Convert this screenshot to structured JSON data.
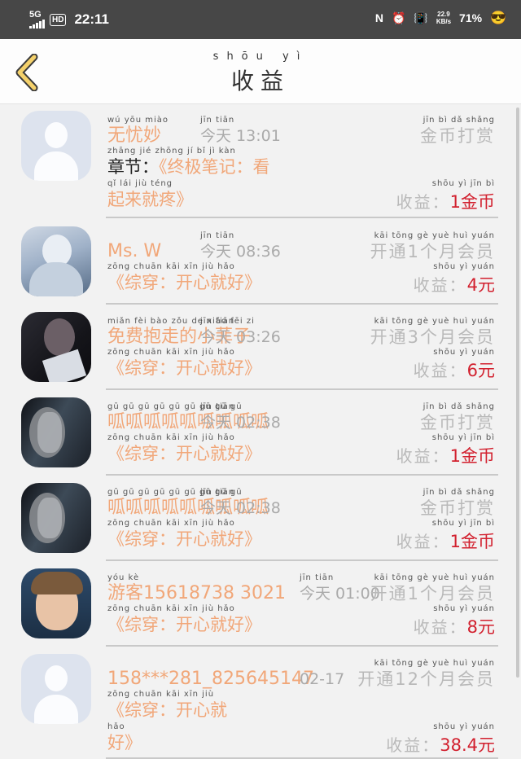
{
  "status_bar": {
    "network": "5G",
    "hd_badge": "HD",
    "time": "22:11",
    "nfc_icon": "N",
    "alarm_icon": "alarm-icon",
    "vibrate_icon": "vibrate-icon",
    "speed_value": "22.9",
    "speed_unit": "KB/s",
    "battery": "71%",
    "emoji": "emoji-sunglasses-icon"
  },
  "header": {
    "title_pinyin": "shōu yì",
    "title": "收益",
    "back_icon": "chevron-left-icon"
  },
  "items": [
    {
      "avatar": "default",
      "name_pinyin": "wú yōu miào",
      "name": "无忧妙",
      "time_pinyin": "jīn tiān",
      "time": "今天 13:01",
      "action_pinyin": "jīn bì dǎ shǎng",
      "action": "金币打赏",
      "note_pinyin": "zhāng jié   zhōng jí bǐ jì kàn",
      "note_prefix": "章节：",
      "note": "《终极笔记：看",
      "note2_pinyin": "qǐ lái jiù téng",
      "note2": "起来就疼》",
      "earn_pinyin": "shōu yì                jīn bì",
      "earn_label": "收益：",
      "earn_value": "1金币"
    },
    {
      "avatar": "anime",
      "name_pinyin": "",
      "name": "Ms. W",
      "time_pinyin": "jīn tiān",
      "time": "今天 08:36",
      "action_pinyin": "kāi tōng gè yuè huì yuán",
      "action": "开通1个月会员",
      "note_pinyin": "zōng chuān  kāi xīn jiù hǎo",
      "note": "《综穿：开心就好》",
      "earn_pinyin": "shōu yì                 yuán",
      "earn_label": "收益：",
      "earn_value": "4元"
    },
    {
      "avatar": "dark",
      "name_pinyin": "miǎn fèi bào zǒu de xiǎo fēi zi",
      "name": "免费抱走的小菲子",
      "time_pinyin": "jīn tiān",
      "time": "今天 03:26",
      "action_pinyin": "kāi tōng gè yuè huì yuán",
      "action": "开通3个月会员",
      "note_pinyin": "zōng chuān  kāi xīn jiù hǎo",
      "note": "《综穿：开心就好》",
      "earn_pinyin": "shōu yì                 yuán",
      "earn_label": "收益：",
      "earn_value": "6元"
    },
    {
      "avatar": "face",
      "name_pinyin": "gū gū gū gū gū gū gū gū gū",
      "name": "呱呱呱呱呱呱呱呱呱",
      "time_pinyin": "jīn tiān",
      "time": "今天 02:38",
      "action_pinyin": "jīn bì dǎ shǎng",
      "action": "金币打赏",
      "note_pinyin": "zōng chuān  kāi xīn jiù hǎo",
      "note": "《综穿：开心就好》",
      "earn_pinyin": "shōu yì                jīn bì",
      "earn_label": "收益：",
      "earn_value": "1金币"
    },
    {
      "avatar": "face",
      "name_pinyin": "gū gū gū gū gū gū gū gū gū",
      "name": "呱呱呱呱呱呱呱呱呱",
      "time_pinyin": "jīn tiān",
      "time": "今天 02:38",
      "action_pinyin": "jīn bì dǎ shǎng",
      "action": "金币打赏",
      "note_pinyin": "zōng chuān  kāi xīn jiù hǎo",
      "note": "《综穿：开心就好》",
      "earn_pinyin": "shōu yì                jīn bì",
      "earn_label": "收益：",
      "earn_value": "1金币"
    },
    {
      "avatar": "boy",
      "name_pinyin": "yóu kè",
      "name": "游客15618738 3021",
      "time_pinyin": "jīn tiān",
      "time": "今天 01:00",
      "action_pinyin": "kāi tōng gè yuè huì yuán",
      "action": "开通1个月会员",
      "note_pinyin": "zōng chuān  kāi xīn jiù hǎo",
      "note": "《综穿：开心就好》",
      "earn_pinyin": "shōu yì                 yuán",
      "earn_label": "收益：",
      "earn_value": "8元"
    },
    {
      "avatar": "default",
      "name_pinyin": "",
      "name": "158***281_825645147",
      "time_pinyin": "",
      "time": "02-17",
      "action_pinyin": "kāi tōng gè yuè huì yuán",
      "action": "开通12个月会员",
      "note_pinyin": "zōng chuān  kāi xīn jiù",
      "note": "《综穿：开心就",
      "note2_pinyin": "hǎo",
      "note2": "好》",
      "earn_pinyin": "shōu yì                 yuán",
      "earn_label": "收益：",
      "earn_value": "38.4元"
    }
  ]
}
